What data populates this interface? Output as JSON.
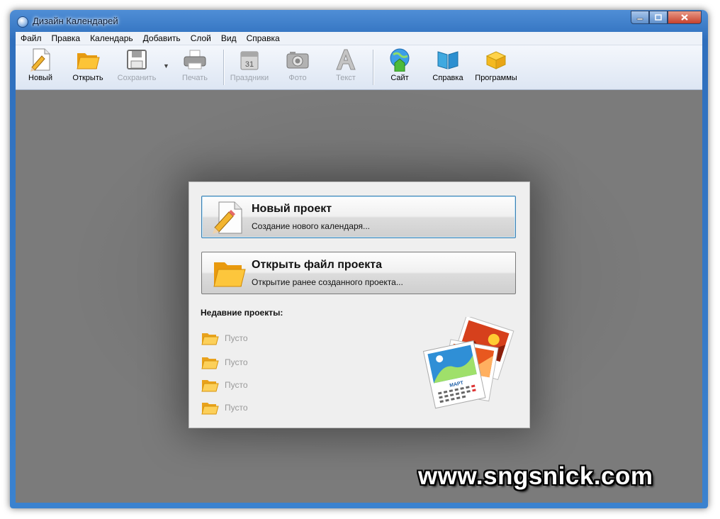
{
  "window": {
    "title": "Дизайн Календарей"
  },
  "menu": [
    "Файл",
    "Правка",
    "Календарь",
    "Добавить",
    "Слой",
    "Вид",
    "Справка"
  ],
  "toolbar": {
    "new": "Новый",
    "open": "Открыть",
    "save": "Сохранить",
    "print": "Печать",
    "holidays": "Праздники",
    "photo": "Фото",
    "text": "Текст",
    "site": "Сайт",
    "help": "Справка",
    "programs": "Программы",
    "calendar_icon_day": "31"
  },
  "dialog": {
    "new_project": {
      "title": "Новый проект",
      "subtitle": "Создание нового календаря..."
    },
    "open_project": {
      "title": "Открыть файл проекта",
      "subtitle": "Открытие ранее созданного проекта..."
    },
    "recent_title": "Недавние проекты:",
    "recent": [
      "Пусто",
      "Пусто",
      "Пусто",
      "Пусто"
    ],
    "art_label": "МАРТ"
  },
  "watermark": "www.sngsnick.com"
}
